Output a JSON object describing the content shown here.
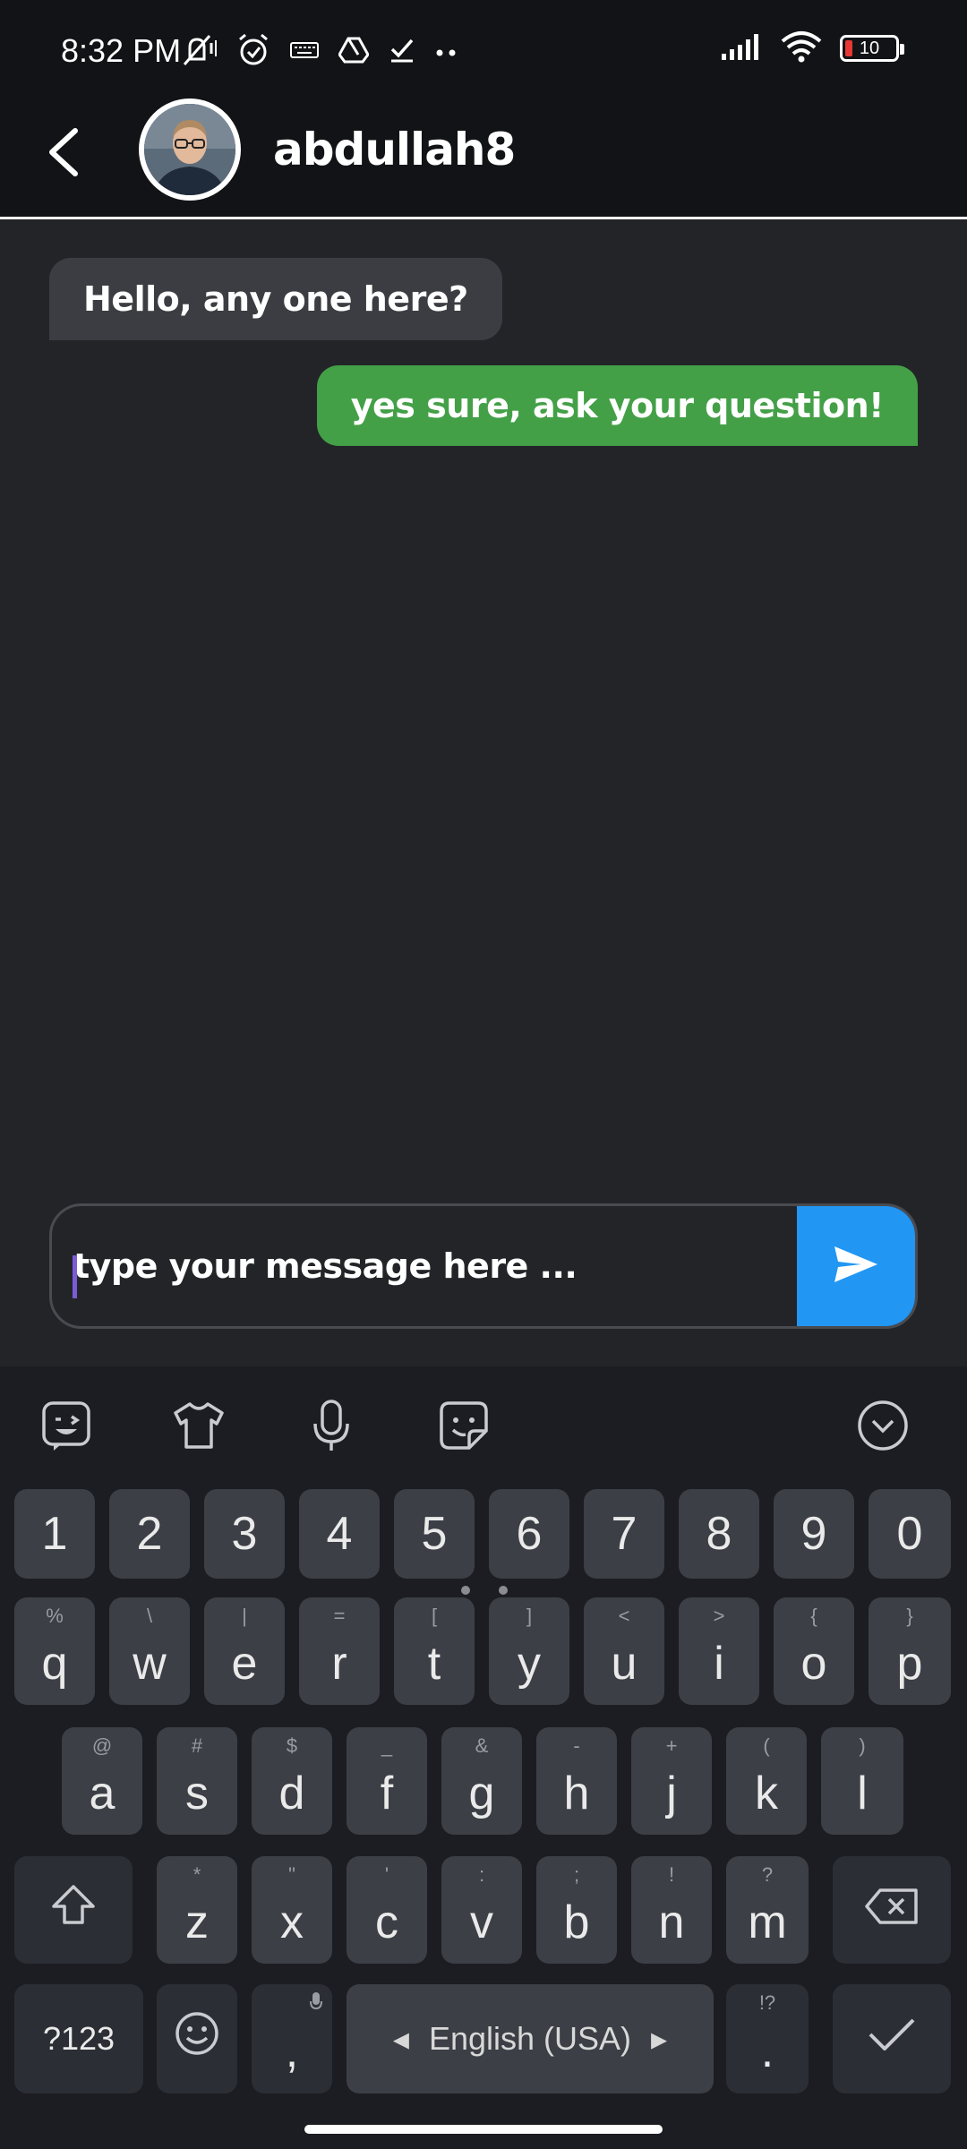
{
  "status_bar": {
    "time": "8:32 PM",
    "left_icons": [
      "mute-icon",
      "alarm-icon",
      "keyboard-icon",
      "drive-icon",
      "check-icon",
      "more-dots-icon"
    ],
    "right_icons": [
      "signal-icon",
      "wifi-icon",
      "battery-icon"
    ],
    "battery_level": "10",
    "battery_color": "#e53935"
  },
  "header": {
    "back_icon": "chevron-left-icon",
    "username": "abdullah8"
  },
  "messages": [
    {
      "direction": "incoming",
      "text": "Hello, any one here?",
      "color": "#3c3d42"
    },
    {
      "direction": "outgoing",
      "text": "yes sure, ask your question!",
      "color": "#43a047"
    }
  ],
  "composer": {
    "placeholder": "type your message here ...",
    "value": "",
    "send_icon": "send-icon",
    "send_color": "#2196f3"
  },
  "keyboard": {
    "toolbar": [
      "sticker-icon",
      "theme-shirt-icon",
      "microphone-icon",
      "emoji-sticker-icon",
      "collapse-keyboard-icon"
    ],
    "number_row": [
      "1",
      "2",
      "3",
      "4",
      "5",
      "6",
      "7",
      "8",
      "9",
      "0"
    ],
    "row1": {
      "keys": [
        "q",
        "w",
        "e",
        "r",
        "t",
        "y",
        "u",
        "i",
        "o",
        "p"
      ],
      "alt": [
        "%",
        "\\",
        "|",
        "=",
        "[",
        "]",
        "<",
        ">",
        "{",
        "}"
      ]
    },
    "row2": {
      "keys": [
        "a",
        "s",
        "d",
        "f",
        "g",
        "h",
        "j",
        "k",
        "l"
      ],
      "alt": [
        "@",
        "#",
        "$",
        "_",
        "&",
        "-",
        "+",
        "(",
        ")"
      ]
    },
    "row3": {
      "keys": [
        "z",
        "x",
        "c",
        "v",
        "b",
        "n",
        "m"
      ],
      "alt": [
        "*",
        "\"",
        "'",
        ":",
        ";",
        "!",
        "?"
      ]
    },
    "symbols_key": "?123",
    "comma": ",",
    "space_label": "English (USA)",
    "period": ".",
    "period_alt": "!?"
  }
}
